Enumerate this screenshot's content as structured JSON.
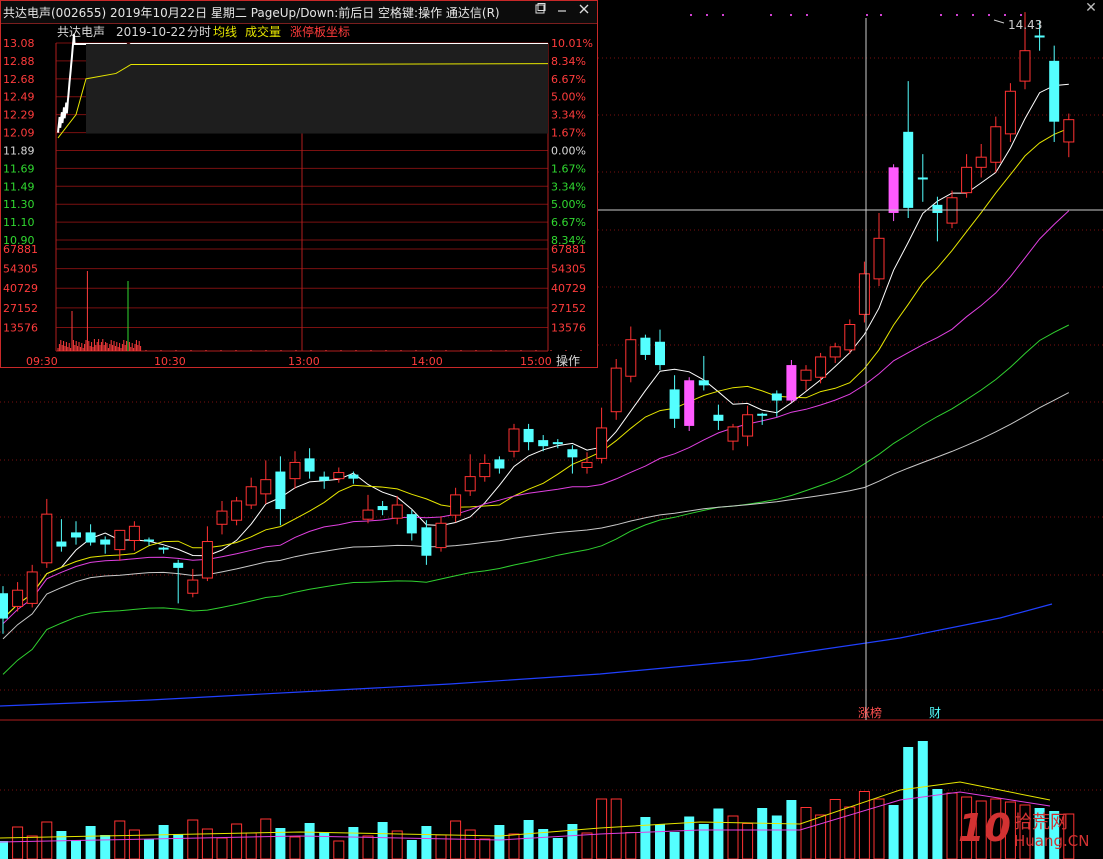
{
  "window": {
    "title": "共达电声(002655) 2019年10月22日 星期二 PageUp/Down:前后日 空格键:操作 通达信(R)",
    "close_glyph": "✕"
  },
  "main_chart": {
    "peak_label": "14.43",
    "markers": [
      "涨榜",
      "财"
    ]
  },
  "intraday": {
    "stock_name": "共达电声",
    "date": "2019-10-22",
    "mode": "分时",
    "legend": [
      {
        "label": "均线",
        "color": "#e6e600"
      },
      {
        "label": "成交量",
        "color": "#e6e600"
      },
      {
        "label": "涨停板坐标",
        "color": "#ff3c3c"
      }
    ],
    "price_ticks": [
      "13.08",
      "12.88",
      "12.68",
      "12.49",
      "12.29",
      "12.09",
      "11.89",
      "11.69",
      "11.49",
      "11.30",
      "11.10",
      "10.90"
    ],
    "pct_ticks": [
      "10.01%",
      "8.34%",
      "6.67%",
      "5.00%",
      "3.34%",
      "1.67%",
      "0.00%",
      "1.67%",
      "3.34%",
      "5.00%",
      "6.67%",
      "8.34%"
    ],
    "volume_ticks": [
      "67881",
      "54305",
      "40729",
      "27152",
      "13576"
    ],
    "time_ticks": [
      "09:30",
      "10:30",
      "13:00",
      "14:00",
      "15:00"
    ],
    "operate_label": "操作"
  },
  "chart_data": [
    {
      "type": "candlestick",
      "candles": [
        {
          "o": 11.45,
          "c": 11.2,
          "h": 11.52,
          "l": 11.05,
          "up": false
        },
        {
          "o": 11.32,
          "c": 11.48,
          "h": 11.56,
          "l": 11.27,
          "up": true
        },
        {
          "o": 11.35,
          "c": 11.66,
          "h": 11.73,
          "l": 11.31,
          "up": true
        },
        {
          "o": 11.75,
          "c": 12.23,
          "h": 12.38,
          "l": 11.7,
          "up": true
        },
        {
          "o": 11.91,
          "c": 11.96,
          "h": 12.18,
          "l": 11.86,
          "up": false
        },
        {
          "o": 12.0,
          "c": 12.05,
          "h": 12.16,
          "l": 11.93,
          "up": false
        },
        {
          "o": 11.95,
          "c": 12.05,
          "h": 12.13,
          "l": 11.92,
          "up": false
        },
        {
          "o": 11.98,
          "c": 11.93,
          "h": 12.01,
          "l": 11.84,
          "up": false
        },
        {
          "o": 12.07,
          "c": 11.88,
          "h": 12.0,
          "l": 11.77,
          "up": true
        },
        {
          "o": 12.11,
          "c": 11.97,
          "h": 12.16,
          "l": 11.87,
          "up": true
        },
        {
          "o": 11.96,
          "c": 11.98,
          "h": 12.0,
          "l": 11.92,
          "up": false
        },
        {
          "o": 11.9,
          "c": 11.88,
          "h": 11.91,
          "l": 11.84,
          "up": false
        },
        {
          "o": 11.75,
          "c": 11.7,
          "h": 11.78,
          "l": 11.35,
          "up": false
        },
        {
          "o": 11.45,
          "c": 11.58,
          "h": 11.69,
          "l": 11.41,
          "up": true
        },
        {
          "o": 11.6,
          "c": 11.96,
          "h": 12.11,
          "l": 11.57,
          "up": true
        },
        {
          "o": 12.13,
          "c": 12.26,
          "h": 12.36,
          "l": 12.03,
          "up": true
        },
        {
          "o": 12.17,
          "c": 12.36,
          "h": 12.4,
          "l": 12.12,
          "up": true
        },
        {
          "o": 12.32,
          "c": 12.5,
          "h": 12.59,
          "l": 12.28,
          "up": true
        },
        {
          "o": 12.43,
          "c": 12.57,
          "h": 12.76,
          "l": 12.33,
          "up": true
        },
        {
          "o": 12.65,
          "c": 12.28,
          "h": 12.8,
          "l": 12.12,
          "up": false
        },
        {
          "o": 12.58,
          "c": 12.74,
          "h": 12.85,
          "l": 12.48,
          "up": true
        },
        {
          "o": 12.78,
          "c": 12.65,
          "h": 12.88,
          "l": 12.58,
          "up": false
        },
        {
          "o": 12.6,
          "c": 12.56,
          "h": 12.65,
          "l": 12.48,
          "up": false
        },
        {
          "o": 12.58,
          "c": 12.64,
          "h": 12.69,
          "l": 12.54,
          "up": true
        },
        {
          "o": 12.62,
          "c": 12.58,
          "h": 12.65,
          "l": 12.53,
          "up": false
        },
        {
          "o": 12.27,
          "c": 12.18,
          "h": 12.42,
          "l": 12.14,
          "up": true
        },
        {
          "o": 12.31,
          "c": 12.27,
          "h": 12.36,
          "l": 12.22,
          "up": false
        },
        {
          "o": 12.19,
          "c": 12.32,
          "h": 12.41,
          "l": 12.13,
          "up": true
        },
        {
          "o": 12.23,
          "c": 12.04,
          "h": 12.27,
          "l": 11.97,
          "up": false
        },
        {
          "o": 12.1,
          "c": 11.82,
          "h": 12.17,
          "l": 11.73,
          "up": false
        },
        {
          "o": 11.9,
          "c": 12.14,
          "h": 12.21,
          "l": 11.86,
          "up": true
        },
        {
          "o": 12.22,
          "c": 12.42,
          "h": 12.49,
          "l": 12.15,
          "up": true
        },
        {
          "o": 12.46,
          "c": 12.6,
          "h": 12.82,
          "l": 12.41,
          "up": true
        },
        {
          "o": 12.6,
          "c": 12.73,
          "h": 12.82,
          "l": 12.55,
          "up": true
        },
        {
          "o": 12.77,
          "c": 12.68,
          "h": 12.8,
          "l": 12.63,
          "up": false
        },
        {
          "o": 12.85,
          "c": 13.07,
          "h": 13.12,
          "l": 12.79,
          "up": true
        },
        {
          "o": 13.07,
          "c": 12.94,
          "h": 13.12,
          "l": 12.86,
          "up": false
        },
        {
          "o": 12.96,
          "c": 12.9,
          "h": 13.01,
          "l": 12.85,
          "up": false
        },
        {
          "o": 12.92,
          "c": 12.94,
          "h": 12.97,
          "l": 12.88,
          "up": false
        },
        {
          "o": 12.87,
          "c": 12.79,
          "h": 12.91,
          "l": 12.63,
          "up": false
        },
        {
          "o": 12.69,
          "c": 12.74,
          "h": 12.84,
          "l": 12.63,
          "up": true
        },
        {
          "o": 12.78,
          "c": 13.08,
          "h": 13.28,
          "l": 12.73,
          "up": true
        },
        {
          "o": 13.24,
          "c": 13.67,
          "h": 13.76,
          "l": 13.16,
          "up": true
        },
        {
          "o": 13.59,
          "c": 13.95,
          "h": 14.08,
          "l": 13.53,
          "up": true
        },
        {
          "o": 13.97,
          "c": 13.8,
          "h": 14.0,
          "l": 13.75,
          "up": false
        },
        {
          "o": 13.93,
          "c": 13.7,
          "h": 14.05,
          "l": 13.65,
          "up": false
        },
        {
          "o": 13.46,
          "c": 13.17,
          "h": 13.6,
          "l": 13.08,
          "up": false
        },
        {
          "o": 13.1,
          "c": 13.55,
          "h": 13.58,
          "l": 13.05,
          "up": false,
          "limit": true
        },
        {
          "o": 13.5,
          "c": 13.55,
          "h": 13.79,
          "l": 13.45,
          "up": false
        },
        {
          "o": 13.15,
          "c": 13.21,
          "h": 13.31,
          "l": 13.06,
          "up": false
        },
        {
          "o": 12.95,
          "c": 13.09,
          "h": 13.12,
          "l": 12.86,
          "up": true
        },
        {
          "o": 13.0,
          "c": 13.21,
          "h": 13.3,
          "l": 12.9,
          "up": true
        },
        {
          "o": 13.2,
          "c": 13.22,
          "h": 13.23,
          "l": 13.11,
          "up": false
        },
        {
          "o": 13.35,
          "c": 13.42,
          "h": 13.45,
          "l": 13.19,
          "up": false
        },
        {
          "o": 13.35,
          "c": 13.7,
          "h": 13.75,
          "l": 13.33,
          "up": false,
          "limit": true
        },
        {
          "o": 13.55,
          "c": 13.65,
          "h": 13.7,
          "l": 13.45,
          "up": true
        },
        {
          "o": 13.58,
          "c": 13.78,
          "h": 13.82,
          "l": 13.52,
          "up": true
        },
        {
          "o": 13.78,
          "c": 13.88,
          "h": 13.92,
          "l": 13.72,
          "up": true
        },
        {
          "o": 13.85,
          "c": 14.1,
          "h": 14.15,
          "l": 13.81,
          "up": true
        },
        {
          "o": 14.2,
          "c": 14.6,
          "h": 14.72,
          "l": 14.12,
          "up": true
        },
        {
          "o": 14.55,
          "c": 14.95,
          "h": 15.2,
          "l": 14.48,
          "up": true
        },
        {
          "o": 15.2,
          "c": 15.65,
          "h": 15.68,
          "l": 15.12,
          "up": false,
          "limit": true
        },
        {
          "o": 16.0,
          "c": 15.25,
          "h": 16.5,
          "l": 15.15,
          "up": false
        },
        {
          "o": 15.55,
          "c": 15.53,
          "h": 15.78,
          "l": 15.31,
          "up": false
        },
        {
          "o": 15.28,
          "c": 15.2,
          "h": 15.36,
          "l": 14.92,
          "up": false
        },
        {
          "o": 15.1,
          "c": 15.35,
          "h": 15.42,
          "l": 15.05,
          "up": true
        },
        {
          "o": 15.4,
          "c": 15.65,
          "h": 15.78,
          "l": 15.35,
          "up": true
        },
        {
          "o": 15.65,
          "c": 15.75,
          "h": 15.88,
          "l": 15.55,
          "up": true
        },
        {
          "o": 15.7,
          "c": 16.05,
          "h": 16.15,
          "l": 15.6,
          "up": true
        },
        {
          "o": 15.98,
          "c": 16.4,
          "h": 16.48,
          "l": 15.9,
          "up": true
        },
        {
          "o": 16.5,
          "c": 16.8,
          "h": 17.18,
          "l": 16.42,
          "up": true
        },
        {
          "o": 16.95,
          "c": 16.93,
          "h": 17.1,
          "l": 16.8,
          "up": false
        },
        {
          "o": 16.7,
          "c": 16.1,
          "h": 16.85,
          "l": 15.9,
          "up": false
        },
        {
          "o": 15.9,
          "c": 16.12,
          "h": 16.18,
          "l": 15.75,
          "up": true
        }
      ]
    },
    {
      "type": "line",
      "x": [
        "09:30",
        "10:30",
        "13:00",
        "14:00",
        "15:00"
      ],
      "ylim": [
        10.9,
        13.08
      ]
    }
  ]
}
